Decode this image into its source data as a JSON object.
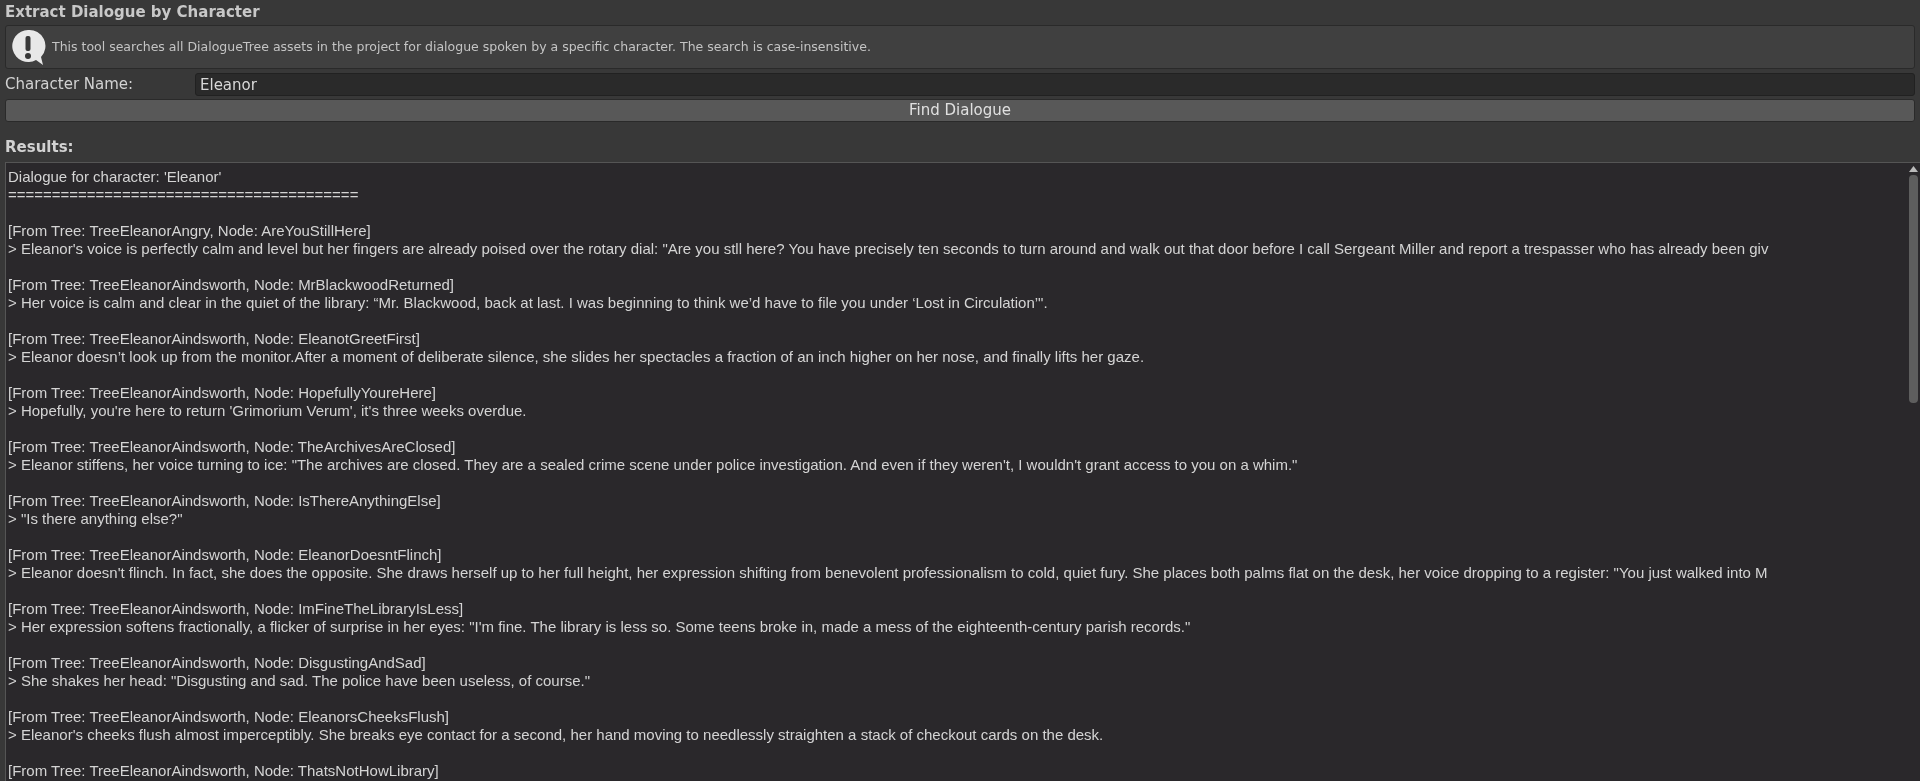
{
  "title": "Extract Dialogue by Character",
  "help": {
    "text": "This tool searches all DialogueTree assets in the project for dialogue spoken by a specific character. The search is case-insensitive."
  },
  "field": {
    "label": "Character Name:",
    "value": "Eleanor"
  },
  "button": "Find Dialogue",
  "results_label": "Results:",
  "results": {
    "heading": "Dialogue for character: 'Eleanor'",
    "separator": "========================================",
    "entries": [
      {
        "source": "[From Tree: TreeEleanorAngry, Node: AreYouStillHere]",
        "line": "> Eleanor's voice is perfectly calm and level but her fingers are already poised over the rotary dial: \"Are you stll here? You have precisely ten seconds to turn around and walk out that door before I call Sergeant Miller and report a trespasser who has already been giv"
      },
      {
        "source": "[From Tree: TreeEleanorAindsworth, Node: MrBlackwoodReturned]",
        "line": "> Her voice is calm and clear in the quiet of the library: “Mr. Blackwood, back at last. I was beginning to think we’d have to file you under ‘Lost in Circulation’\"."
      },
      {
        "source": "[From Tree: TreeEleanorAindsworth, Node: EleanotGreetFirst]",
        "line": "> Eleanor doesn’t look up from the monitor.After a moment of deliberate silence, she slides her spectacles a fraction of an inch higher on her nose, and finally lifts her gaze."
      },
      {
        "source": "[From Tree: TreeEleanorAindsworth, Node: HopefullyYoureHere]",
        "line": "> Hopefully, you're here to return 'Grimorium Verum', it's three weeks overdue."
      },
      {
        "source": "[From Tree: TreeEleanorAindsworth, Node: TheArchivesAreClosed]",
        "line": "> Eleanor stiffens, her voice turning to ice: \"The archives are closed. They are a sealed crime scene under police investigation. And even if they weren't, I wouldn't grant access to you on a whim.\""
      },
      {
        "source": "[From Tree: TreeEleanorAindsworth, Node: IsThereAnythingElse]",
        "line": "> \"Is there anything else?\""
      },
      {
        "source": "[From Tree: TreeEleanorAindsworth, Node: EleanorDoesntFlinch]",
        "line": "> Eleanor doesn't flinch. In fact, she does the opposite. She draws herself up to her full height, her expression shifting from benevolent professionalism to cold, quiet fury. She places both palms flat on the desk, her voice dropping to a register: \"You just walked into M"
      },
      {
        "source": "[From Tree: TreeEleanorAindsworth, Node: ImFineTheLibraryIsLess]",
        "line": "> Her expression softens fractionally, a flicker of surprise in her eyes: \"I'm fine. The library is less so. Some teens broke in, made a mess of the eighteenth-century parish records.\""
      },
      {
        "source": "[From Tree: TreeEleanorAindsworth, Node: DisgustingAndSad]",
        "line": "> She shakes her head: \"Disgusting and sad. The police have been useless, of course.\""
      },
      {
        "source": "[From Tree: TreeEleanorAindsworth, Node: EleanorsCheeksFlush]",
        "line": "> Eleanor's cheeks flush almost imperceptibly. She breaks eye contact for a second, her hand moving to needlessly straighten a stack of checkout cards on the desk."
      },
      {
        "source": "[From Tree: TreeEleanorAindsworth, Node: ThatsNotHowLibrary]"
      }
    ]
  }
}
